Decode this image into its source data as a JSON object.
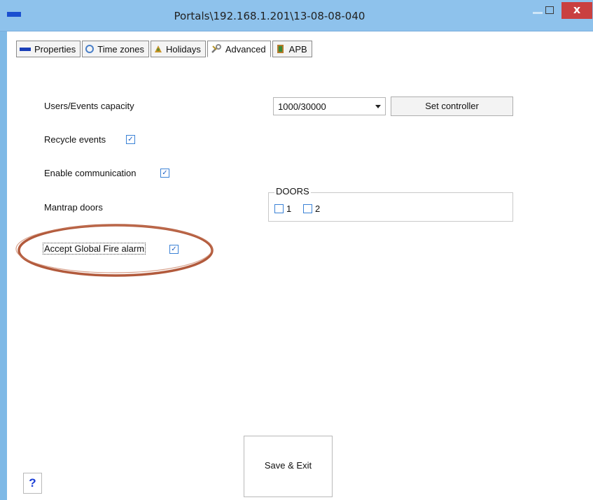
{
  "window": {
    "title": "Portals\\192.168.1.201\\13-08-08-040",
    "close_glyph": "x"
  },
  "tabs": [
    {
      "label": "Properties",
      "icon": "properties-icon"
    },
    {
      "label": "Time zones",
      "icon": "clock-icon"
    },
    {
      "label": "Holidays",
      "icon": "holidays-icon"
    },
    {
      "label": "Advanced",
      "icon": "tools-icon",
      "active": true
    },
    {
      "label": "APB",
      "icon": "apb-icon"
    }
  ],
  "capacity": {
    "label": "Users/Events capacity",
    "selected": "1000/30000",
    "set_button": "Set controller"
  },
  "recycle": {
    "label": "Recycle events",
    "checked": true
  },
  "communication": {
    "label": "Enable communication",
    "checked": true
  },
  "mantrap": {
    "label": "Mantrap doors",
    "group_title": "DOORS",
    "doors": [
      {
        "label": "1",
        "checked": false
      },
      {
        "label": "2",
        "checked": false
      }
    ]
  },
  "fire_alarm": {
    "label": "Accept Global Fire alarm",
    "checked": true
  },
  "actions": {
    "save_exit": "Save & Exit",
    "help": "?"
  },
  "colors": {
    "titlebar": "#8ec2ec",
    "close": "#c94040",
    "highlight_ellipse": "#b25a3c",
    "checkbox": "#3b82d6"
  }
}
